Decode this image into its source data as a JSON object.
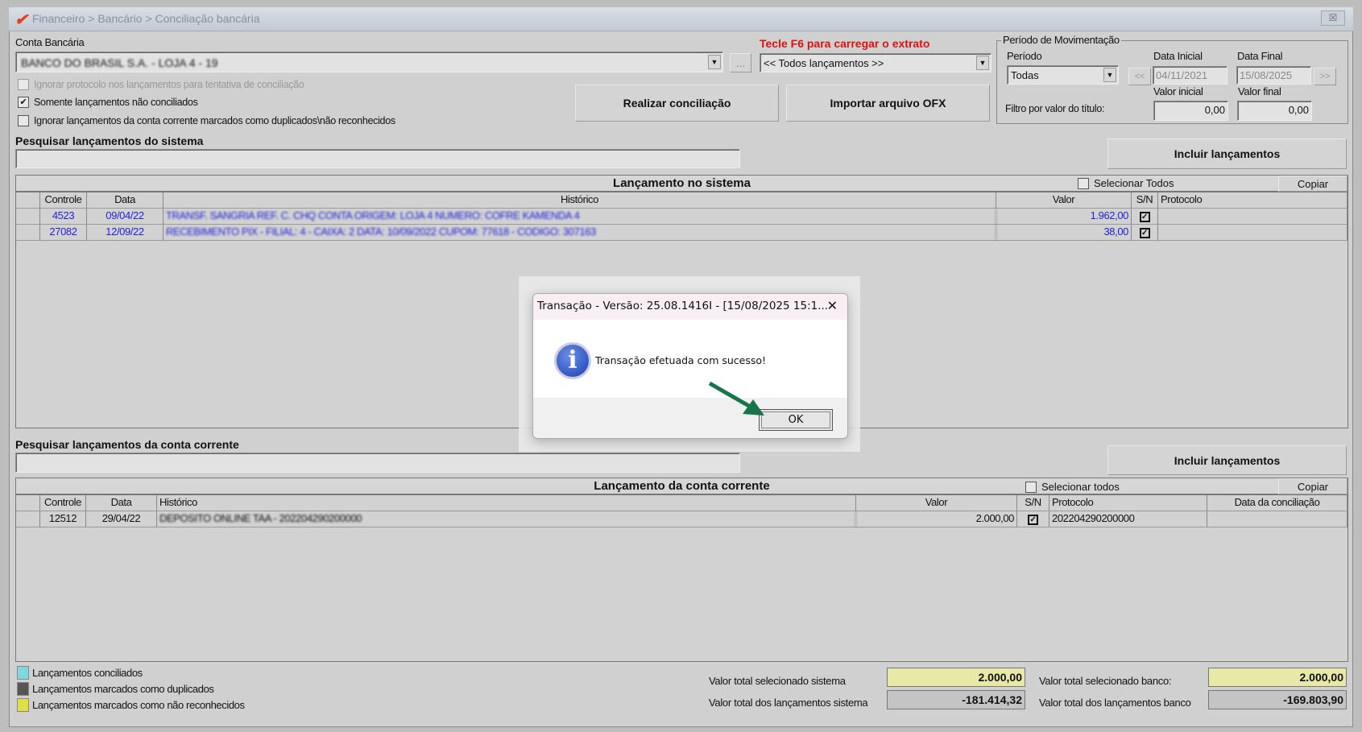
{
  "window": {
    "breadcrumb": "Financeiro > Bancário > Conciliação bancária",
    "close": "☒"
  },
  "top": {
    "conta_label": "Conta Bancária",
    "conta_value": "BANCO DO BRASIL S.A. - LOJA 4 - 19",
    "ellipsis": "...",
    "f6_hint": "Tecle F6 para carregar o extrato",
    "extrato_value": "<< Todos lançamentos >>",
    "checks": [
      {
        "label": "Ignorar protocolo nos lançamentos para tentativa de conciliação",
        "checked": false,
        "disabled": true
      },
      {
        "label": "Somente lançamentos não conciliados",
        "checked": true
      },
      {
        "label": "Ignorar lançamentos da conta corrente marcados como duplicados\\não reconhecidos",
        "checked": false
      }
    ],
    "realizar": "Realizar conciliação",
    "importar": "Importar arquivo OFX"
  },
  "periodo": {
    "title": "Período de Movimentação",
    "periodo_label": "Período",
    "periodo_value": "Todas",
    "data_inicial_label": "Data Inicial",
    "data_inicial": "04/11/2021",
    "data_final_label": "Data Final",
    "data_final": "15/08/2025",
    "prev": "<<",
    "next": ">>",
    "valor_inicial_label": "Valor inicial",
    "valor_final_label": "Valor final",
    "filtro_label": "Filtro por valor do título:",
    "valor_inicial": "0,00",
    "valor_final": "0,00"
  },
  "sistema": {
    "search_label": "Pesquisar lançamentos do sistema",
    "incluir": "Incluir lançamentos",
    "title": "Lançamento no sistema",
    "select_all": "Selecionar Todos",
    "copiar": "Copiar",
    "columns": [
      "Controle",
      "Data",
      "Histórico",
      "Valor",
      "S/N",
      "Protocolo"
    ],
    "rows": [
      {
        "controle": "4523",
        "data": "09/04/22",
        "historico": "TRANSF. SANGRIA REF. C. CHQ CONTA ORIGEM: LOJA 4 NUMERO: COFRE KAMENDA 4",
        "valor": "1.962,00",
        "sn": true,
        "protocolo": ""
      },
      {
        "controle": "27082",
        "data": "12/09/22",
        "historico": "RECEBIMENTO PIX - FILIAL: 4 - CAIXA: 2 DATA: 10/09/2022 CUPOM: 77618 - CODIGO: 307163",
        "valor": "38,00",
        "sn": true,
        "protocolo": ""
      }
    ]
  },
  "conta": {
    "search_label": "Pesquisar lançamentos da conta corrente",
    "incluir": "Incluir lançamentos",
    "title": "Lançamento da conta corrente",
    "select_all": "Selecionar todos",
    "copiar": "Copiar",
    "columns": [
      "Controle",
      "Data",
      "Histórico",
      "Valor",
      "S/N",
      "Protocolo",
      "Data da conciliação"
    ],
    "rows": [
      {
        "controle": "12512",
        "data": "29/04/22",
        "historico": "DEPOSITO ONLINE TAA - 202204290200000",
        "valor": "2.000,00",
        "sn": true,
        "protocolo": "202204290200000",
        "data_conc": ""
      }
    ]
  },
  "legend": [
    {
      "label": "Lançamentos conciliados",
      "color": "#7fd8df"
    },
    {
      "label": "Lançamentos marcados como duplicados",
      "color": "#555555"
    },
    {
      "label": "Lançamentos marcados como não reconhecidos",
      "color": "#e0e040"
    }
  ],
  "totals": {
    "sel_sis_label": "Valor total selecionado sistema",
    "sel_sis": "2.000,00",
    "tot_sis_label": "Valor total dos lançamentos sistema",
    "tot_sis": "-181.414,32",
    "sel_banco_label": "Valor total selecionado banco:",
    "sel_banco": "2.000,00",
    "tot_banco_label": "Valor total dos lançamentos banco",
    "tot_banco": "-169.803,90"
  },
  "dialog": {
    "title": "Transação - Versão: 25.08.1416I - [15/08/2025 15:1...",
    "close": "✕",
    "message": "Transação efetuada com sucesso!",
    "ok": "OK"
  }
}
